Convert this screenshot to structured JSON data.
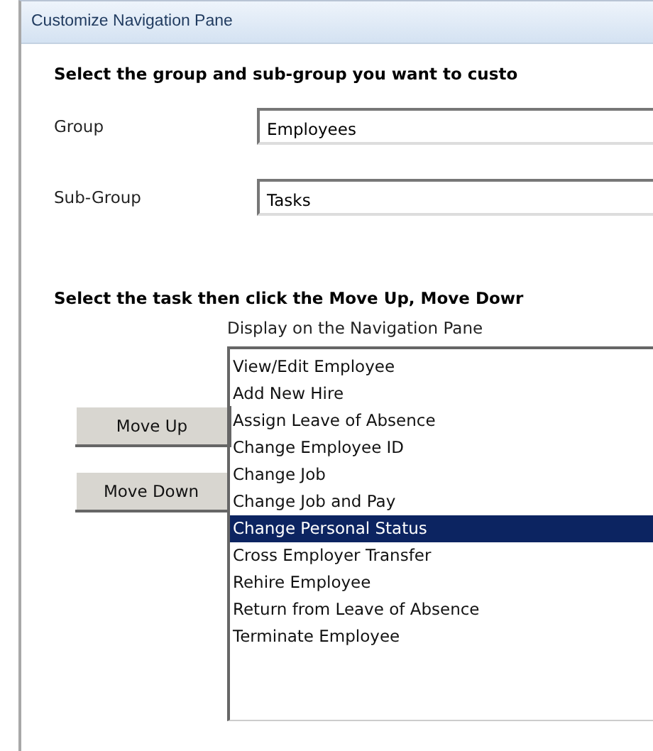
{
  "window": {
    "title": "Customize Navigation Pane"
  },
  "heading": "Select the group and sub-group you want to custo",
  "fields": [
    {
      "label": "Group",
      "value": "Employees"
    },
    {
      "label": "Sub-Group",
      "value": "Tasks"
    }
  ],
  "instruction": "Select the task then click the Move Up, Move Dowr",
  "list": {
    "caption": "Display on the Navigation Pane",
    "items": [
      {
        "label": "View/Edit Employee",
        "selected": false
      },
      {
        "label": "Add New Hire",
        "selected": false
      },
      {
        "label": "Assign Leave of Absence",
        "selected": false
      },
      {
        "label": "Change Employee ID",
        "selected": false
      },
      {
        "label": "Change Job",
        "selected": false
      },
      {
        "label": "Change Job and Pay",
        "selected": false
      },
      {
        "label": "Change Personal Status",
        "selected": true
      },
      {
        "label": "Cross Employer Transfer",
        "selected": false
      },
      {
        "label": "Rehire Employee",
        "selected": false
      },
      {
        "label": "Return from Leave of Absence",
        "selected": false
      },
      {
        "label": "Terminate Employee",
        "selected": false
      }
    ]
  },
  "buttons": [
    "Move Up",
    "Move Down"
  ]
}
